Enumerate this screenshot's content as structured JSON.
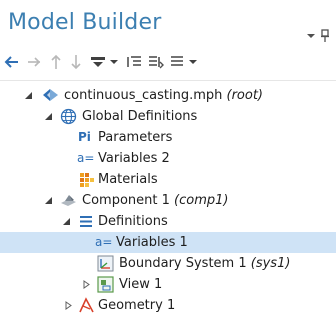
{
  "panel": {
    "title": "Model Builder"
  },
  "colors": {
    "title": "#3c7fb1",
    "selection": "#cfe3f6",
    "icon_gray": "#606060",
    "icon_blue": "#2f6fb5",
    "icon_orange": "#f0a020",
    "icon_red": "#d9412b"
  },
  "toolbar": {
    "items": [
      {
        "icon": "arrow-left-icon"
      },
      {
        "icon": "arrow-right-icon"
      },
      {
        "icon": "arrow-up-icon"
      },
      {
        "icon": "arrow-down-icon"
      },
      {
        "icon": "show-options-icon"
      },
      {
        "icon": "expand-all-icon"
      },
      {
        "icon": "collapse-all-icon"
      },
      {
        "icon": "list-options-icon"
      }
    ]
  },
  "tree": {
    "nodes": [
      {
        "label": "continuous_casting.mph",
        "tag": "(root)",
        "icon": "model-root-icon",
        "expanded": true,
        "level": 0
      },
      {
        "label": "Global Definitions",
        "tag": "",
        "icon": "globe-icon",
        "expanded": true,
        "level": 1
      },
      {
        "label": "Parameters",
        "tag": "",
        "icon": "parameters-icon",
        "glyph": "Pi",
        "level": 2
      },
      {
        "label": "Variables 2",
        "tag": "",
        "icon": "variables-icon",
        "glyph": "a=",
        "level": 2
      },
      {
        "label": "Materials",
        "tag": "",
        "icon": "materials-icon",
        "level": 2
      },
      {
        "label": "Component 1",
        "tag": "(comp1)",
        "icon": "component-icon",
        "expanded": true,
        "level": 1
      },
      {
        "label": "Definitions",
        "tag": "",
        "icon": "definitions-icon",
        "expanded": true,
        "level": 2
      },
      {
        "label": "Variables 1",
        "tag": "",
        "icon": "variables-icon",
        "glyph": "a=",
        "level": 3,
        "selected": true
      },
      {
        "label": "Boundary System 1",
        "tag": "(sys1)",
        "icon": "boundary-system-icon",
        "level": 3
      },
      {
        "label": "View 1",
        "tag": "",
        "icon": "view-icon",
        "expanded": false,
        "level": 3
      },
      {
        "label": "Geometry 1",
        "tag": "",
        "icon": "geometry-icon",
        "expanded": false,
        "level": 2
      }
    ]
  }
}
